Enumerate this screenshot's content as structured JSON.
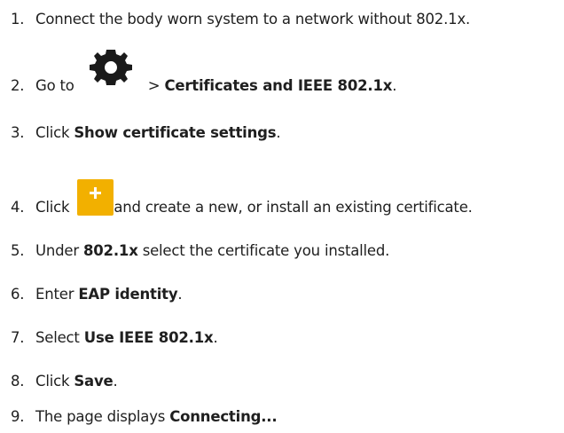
{
  "steps": [
    {
      "num": "1.",
      "parts": [
        "Connect the body worn system to a network without 802.1x."
      ]
    },
    {
      "num": "2.",
      "go_to": "Go to",
      "gt": ">",
      "bold": "Certificates and IEEE 802.1x",
      "tail": "."
    },
    {
      "num": "3.",
      "pre": "Click",
      "bold": "Show certificate settings",
      "tail": "."
    },
    {
      "num": "4.",
      "pre": "Click",
      "post": "and create a new, or install an existing certificate."
    },
    {
      "num": "5.",
      "pre": "Under",
      "bold": "802.1x",
      "post": "select the certificate you installed."
    },
    {
      "num": "6.",
      "pre": "Enter",
      "bold": "EAP identity",
      "tail": "."
    },
    {
      "num": "7.",
      "pre": "Select",
      "bold": "Use IEEE 802.1x",
      "tail": "."
    },
    {
      "num": "8.",
      "pre": "Click",
      "bold": "Save",
      "tail": "."
    },
    {
      "num": "9.",
      "pre": "The page displays",
      "bold": "Connecting..."
    }
  ],
  "icons": {
    "settings": "gear-icon",
    "add": "plus-icon",
    "add_color": "#f2b000",
    "gear_color": "#1a1a1a"
  }
}
